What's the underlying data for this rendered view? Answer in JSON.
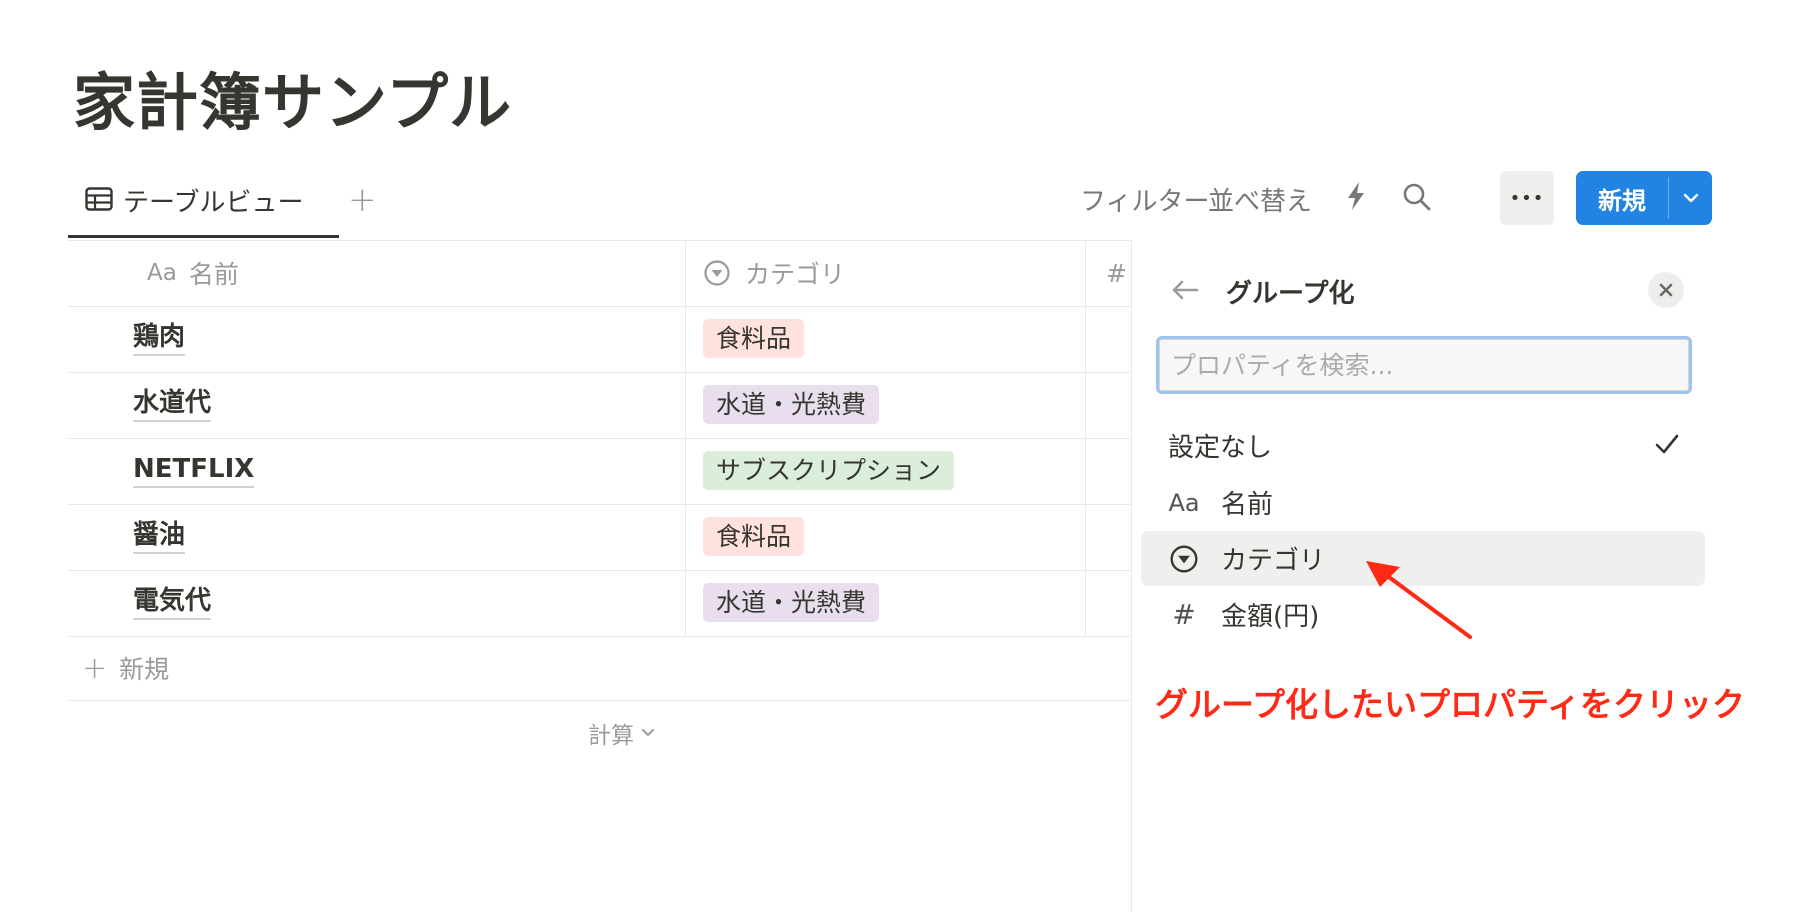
{
  "page": {
    "title": "家計簿サンプル"
  },
  "toolbar": {
    "view_tab_label": "テーブルビュー",
    "filter_label": "フィルター",
    "sort_label": "並べ替え",
    "more_label": "•••",
    "new_label": "新規"
  },
  "table": {
    "columns": [
      {
        "prefix": "Aa",
        "label": "名前"
      },
      {
        "label": "カテゴリ"
      },
      {
        "label": "#"
      }
    ],
    "rows": [
      {
        "name": "鶏肉",
        "category": "食料品"
      },
      {
        "name": "水道代",
        "category": "水道・光熱費"
      },
      {
        "name": "NETFLIX",
        "category": "サブスクリプション"
      },
      {
        "name": "醤油",
        "category": "食料品"
      },
      {
        "name": "電気代",
        "category": "水道・光熱費"
      }
    ],
    "new_row_label": "新規",
    "calc_label": "計算"
  },
  "tag_colors": {
    "食料品": "#ffe2dd",
    "水道・光熱費": "#e8deee",
    "サブスクリプション": "#dbeddb"
  },
  "group_panel": {
    "title": "グループ化",
    "search_placeholder": "プロパティを検索...",
    "options": [
      {
        "icon": "",
        "label": "設定なし",
        "selected": true
      },
      {
        "icon": "Aa",
        "label": "名前"
      },
      {
        "icon": "select-icon",
        "label": "カテゴリ"
      },
      {
        "icon": "#",
        "label": "金額(円)"
      }
    ]
  },
  "annotation": {
    "text": "グループ化したいプロパティをクリック",
    "color": "#ff2a15"
  }
}
